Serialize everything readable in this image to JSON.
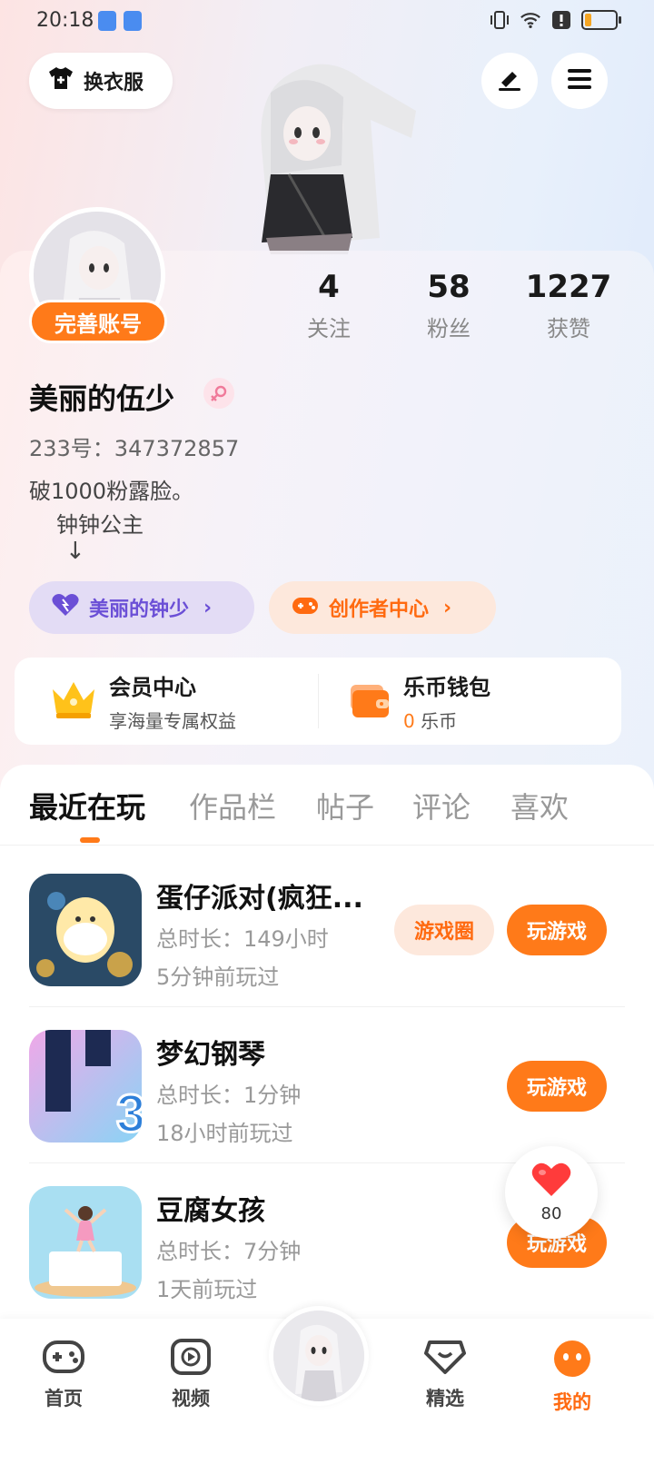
{
  "status_bar": {
    "time": "20:18"
  },
  "header": {
    "outfit_label": "换衣服",
    "icons": [
      "tshirt-icon",
      "edit-icon",
      "menu-icon"
    ]
  },
  "profile": {
    "complete_account_label": "完善账号",
    "stats": [
      {
        "value": "4",
        "label": "关注"
      },
      {
        "value": "58",
        "label": "粉丝"
      },
      {
        "value": "1227",
        "label": "获赞"
      }
    ],
    "name": "美丽的伍少",
    "uid": "233号：347372857",
    "bio_line1": "破1000粉露脸。",
    "bio_line2": "钟钟公主",
    "bio_line3": "↓",
    "fan_group_label": "美丽的钟少",
    "creator_center_label": "创作者中心"
  },
  "member": {
    "vip_title": "会员中心",
    "vip_sub": "享海量专属权益",
    "wallet_title": "乐币钱包",
    "wallet_amount": "0",
    "wallet_unit": " 乐币"
  },
  "tabs": [
    "最近在玩",
    "作品栏",
    "帖子",
    "评论",
    "喜欢"
  ],
  "games": [
    {
      "name": "蛋仔派对(疯狂...",
      "duration": "总时长：149小时",
      "last_played": "5分钟前玩过",
      "circle_label": "游戏圈",
      "play_label": "玩游戏"
    },
    {
      "name": "梦幻钢琴",
      "duration": "总时长：1分钟",
      "last_played": "18小时前玩过",
      "play_label": "玩游戏"
    },
    {
      "name": "豆腐女孩",
      "duration": "总时长：7分钟",
      "last_played": "1天前玩过",
      "play_label": "玩游戏"
    }
  ],
  "float_like": {
    "count": "80"
  },
  "bottom_nav": [
    {
      "label": "首页",
      "icon": "gamepad-icon"
    },
    {
      "label": "视频",
      "icon": "video-icon"
    },
    {
      "label": "精选",
      "icon": "heart-shield-icon"
    },
    {
      "label": "我的",
      "icon": "profile-face-icon"
    }
  ],
  "colors": {
    "accent": "#ff7a19",
    "purple": "#6b4fd6"
  }
}
